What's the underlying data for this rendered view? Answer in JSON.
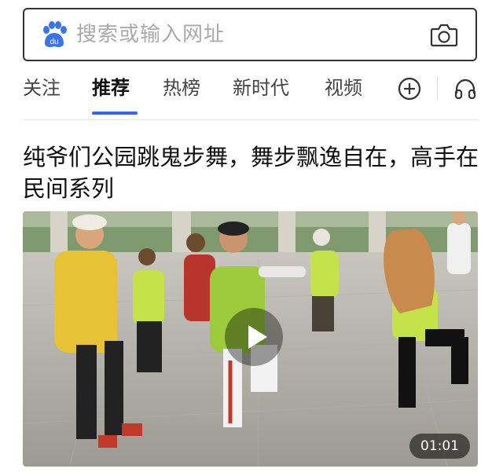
{
  "search": {
    "placeholder": "搜索或输入网址",
    "logo_text": "du",
    "logo_icon": "baidu-paw-icon",
    "camera_icon": "camera-icon"
  },
  "tabs": [
    {
      "label": "关注",
      "active": false
    },
    {
      "label": "推荐",
      "active": true
    },
    {
      "label": "热榜",
      "active": false
    },
    {
      "label": "新时代",
      "active": false
    },
    {
      "label": "视频",
      "active": false
    }
  ],
  "tab_actions": {
    "add_icon": "plus-circle-icon",
    "listen_icon": "headphones-icon"
  },
  "accent_color": "#3268f0",
  "feed": {
    "headline": "纯爷们公园跳鬼步舞，舞步飘逸自在，高手在民间系列",
    "video": {
      "duration": "01:01",
      "play_icon": "play-icon"
    }
  }
}
